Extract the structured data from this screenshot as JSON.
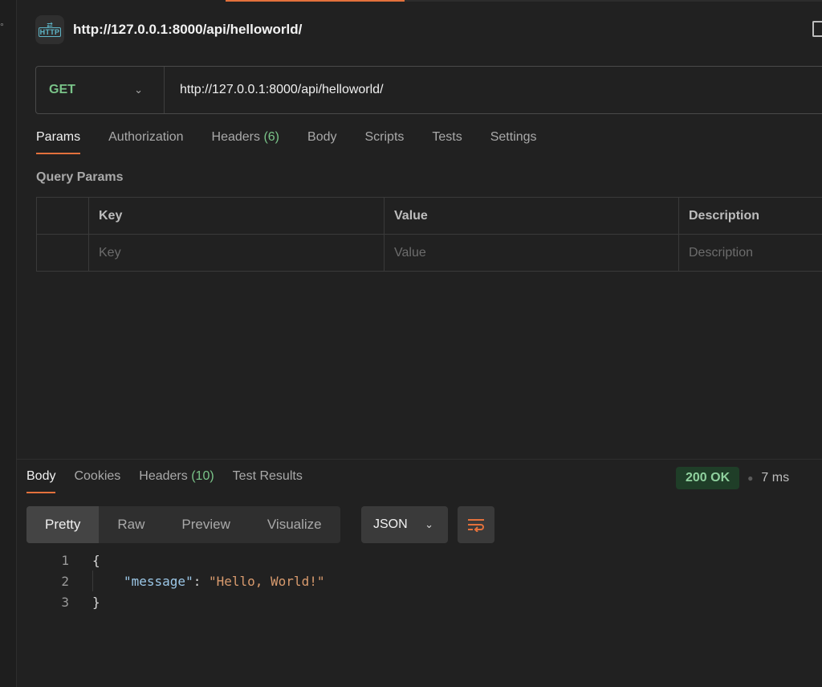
{
  "header": {
    "title": "http://127.0.0.1:8000/api/helloworld/",
    "badge": "HTTP"
  },
  "request": {
    "method": "GET",
    "url": "http://127.0.0.1:8000/api/helloworld/",
    "tabs": [
      {
        "label": "Params"
      },
      {
        "label": "Authorization"
      },
      {
        "label": "Headers",
        "count": "(6)"
      },
      {
        "label": "Body"
      },
      {
        "label": "Scripts"
      },
      {
        "label": "Tests"
      },
      {
        "label": "Settings"
      }
    ],
    "active_tab": "Params"
  },
  "query_params": {
    "title": "Query Params",
    "columns": [
      "Key",
      "Value",
      "Description"
    ],
    "placeholders": [
      "Key",
      "Value",
      "Description"
    ]
  },
  "response": {
    "tabs": [
      {
        "label": "Body"
      },
      {
        "label": "Cookies"
      },
      {
        "label": "Headers",
        "count": "(10)"
      },
      {
        "label": "Test Results"
      }
    ],
    "active_tab": "Body",
    "status": "200 OK",
    "time": "7 ms",
    "views": [
      "Pretty",
      "Raw",
      "Preview",
      "Visualize"
    ],
    "active_view": "Pretty",
    "format": "JSON",
    "code": {
      "line_numbers": [
        "1",
        "2",
        "3"
      ],
      "open": "{",
      "key": "\"message\"",
      "colon": ": ",
      "value": "\"Hello, World!\"",
      "close": "}"
    }
  },
  "colors": {
    "accent": "#e3713c",
    "method_get": "#7ac489",
    "status_ok": "#8fd19e"
  }
}
